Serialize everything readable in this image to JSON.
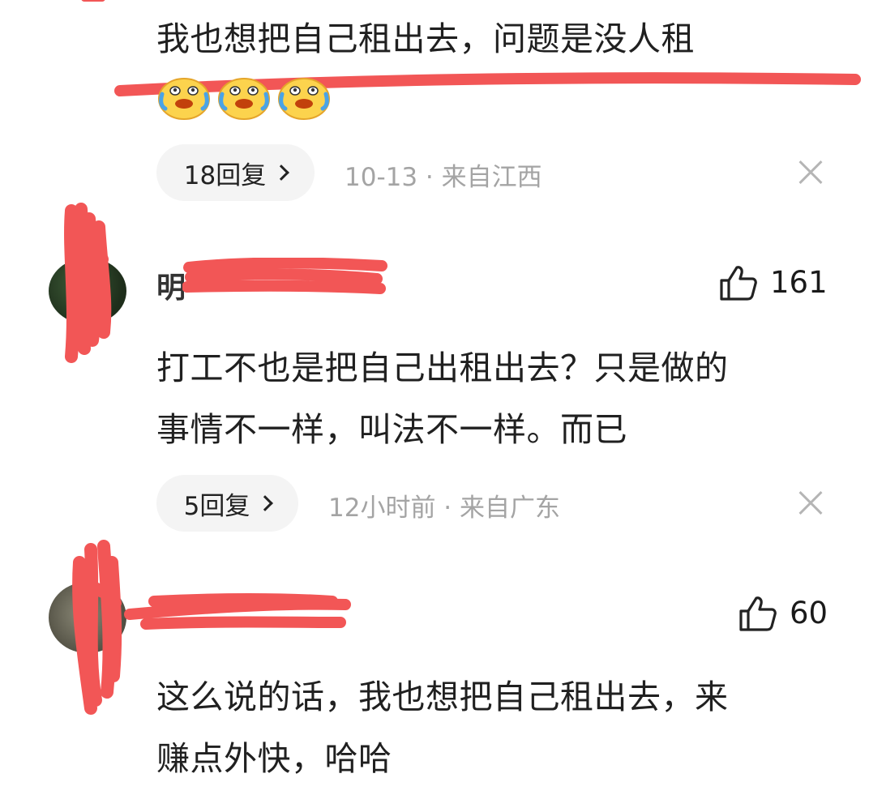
{
  "comments": [
    {
      "text_line1": "我也想把自己租出去，问题是没人租",
      "emoji_icon": "crying-laughing-face-icon",
      "reply_label": "18回复",
      "meta": "10-13 · 来自江西"
    },
    {
      "username": "明",
      "likes": "161",
      "text_line1": "打工不也是把自己出租出去？只是做的",
      "text_line2": "事情不一样，叫法不一样。而已",
      "reply_label": "5回复",
      "meta": "12小时前 · 来自广东"
    },
    {
      "username": "",
      "likes": "60",
      "text_line1": "这么说的话，我也想把自己租出去，来",
      "text_line2": "赚点外快，哈哈"
    }
  ],
  "colors": {
    "redaction_red": "#f25656",
    "meta_gray": "#a4a4a4",
    "pill_bg": "#f4f4f4"
  }
}
